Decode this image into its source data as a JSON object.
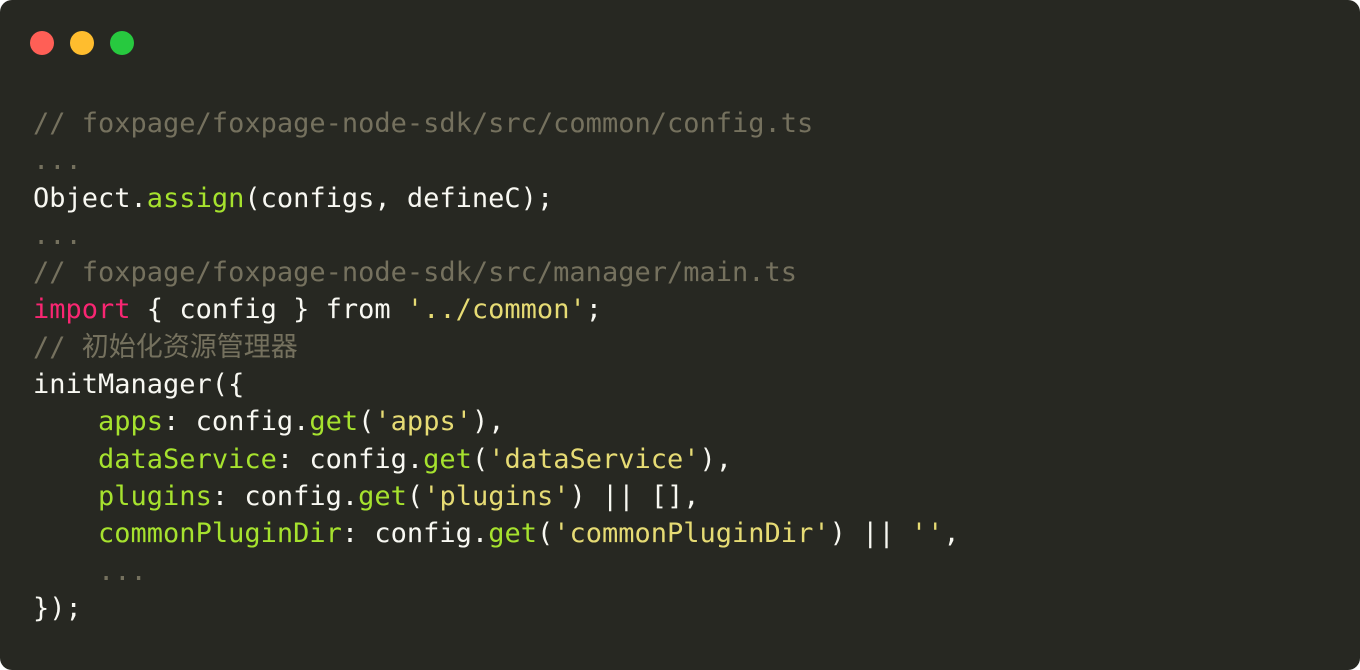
{
  "window": {
    "controls": [
      "close",
      "minimize",
      "zoom"
    ],
    "colors": {
      "background": "#272822",
      "close": "#ff5f56",
      "minimize": "#ffbd2e",
      "zoom": "#27c93f"
    }
  },
  "code": {
    "lines": [
      [
        {
          "t": "// foxpage/foxpage-node-sdk/src/common/config.ts",
          "c": "comment"
        }
      ],
      [
        {
          "t": "...",
          "c": "comment"
        }
      ],
      [
        {
          "t": "Object.",
          "c": "plain"
        },
        {
          "t": "assign",
          "c": "function"
        },
        {
          "t": "(configs, defineC);",
          "c": "plain"
        }
      ],
      [
        {
          "t": "...",
          "c": "comment"
        }
      ],
      [
        {
          "t": "// foxpage/foxpage-node-sdk/src/manager/main.ts",
          "c": "comment"
        }
      ],
      [
        {
          "t": "import",
          "c": "keyword"
        },
        {
          "t": " { config } from ",
          "c": "plain"
        },
        {
          "t": "'../common'",
          "c": "string"
        },
        {
          "t": ";",
          "c": "plain"
        }
      ],
      [
        {
          "t": "// 初始化资源管理器",
          "c": "comment"
        }
      ],
      [
        {
          "t": "initManager({",
          "c": "plain"
        }
      ],
      [
        {
          "t": "    ",
          "c": "plain"
        },
        {
          "t": "apps",
          "c": "property"
        },
        {
          "t": ": config.",
          "c": "plain"
        },
        {
          "t": "get",
          "c": "function"
        },
        {
          "t": "(",
          "c": "plain"
        },
        {
          "t": "'apps'",
          "c": "string"
        },
        {
          "t": "),",
          "c": "plain"
        }
      ],
      [
        {
          "t": "    ",
          "c": "plain"
        },
        {
          "t": "dataService",
          "c": "property"
        },
        {
          "t": ": config.",
          "c": "plain"
        },
        {
          "t": "get",
          "c": "function"
        },
        {
          "t": "(",
          "c": "plain"
        },
        {
          "t": "'dataService'",
          "c": "string"
        },
        {
          "t": "),",
          "c": "plain"
        }
      ],
      [
        {
          "t": "    ",
          "c": "plain"
        },
        {
          "t": "plugins",
          "c": "property"
        },
        {
          "t": ": config.",
          "c": "plain"
        },
        {
          "t": "get",
          "c": "function"
        },
        {
          "t": "(",
          "c": "plain"
        },
        {
          "t": "'plugins'",
          "c": "string"
        },
        {
          "t": ") || [],",
          "c": "plain"
        }
      ],
      [
        {
          "t": "    ",
          "c": "plain"
        },
        {
          "t": "commonPluginDir",
          "c": "property"
        },
        {
          "t": ": config.",
          "c": "plain"
        },
        {
          "t": "get",
          "c": "function"
        },
        {
          "t": "(",
          "c": "plain"
        },
        {
          "t": "'commonPluginDir'",
          "c": "string"
        },
        {
          "t": ") || ",
          "c": "plain"
        },
        {
          "t": "''",
          "c": "string"
        },
        {
          "t": ",",
          "c": "plain"
        }
      ],
      [
        {
          "t": "    ",
          "c": "plain"
        },
        {
          "t": "...",
          "c": "comment"
        }
      ],
      [
        {
          "t": "});",
          "c": "plain"
        }
      ]
    ]
  }
}
